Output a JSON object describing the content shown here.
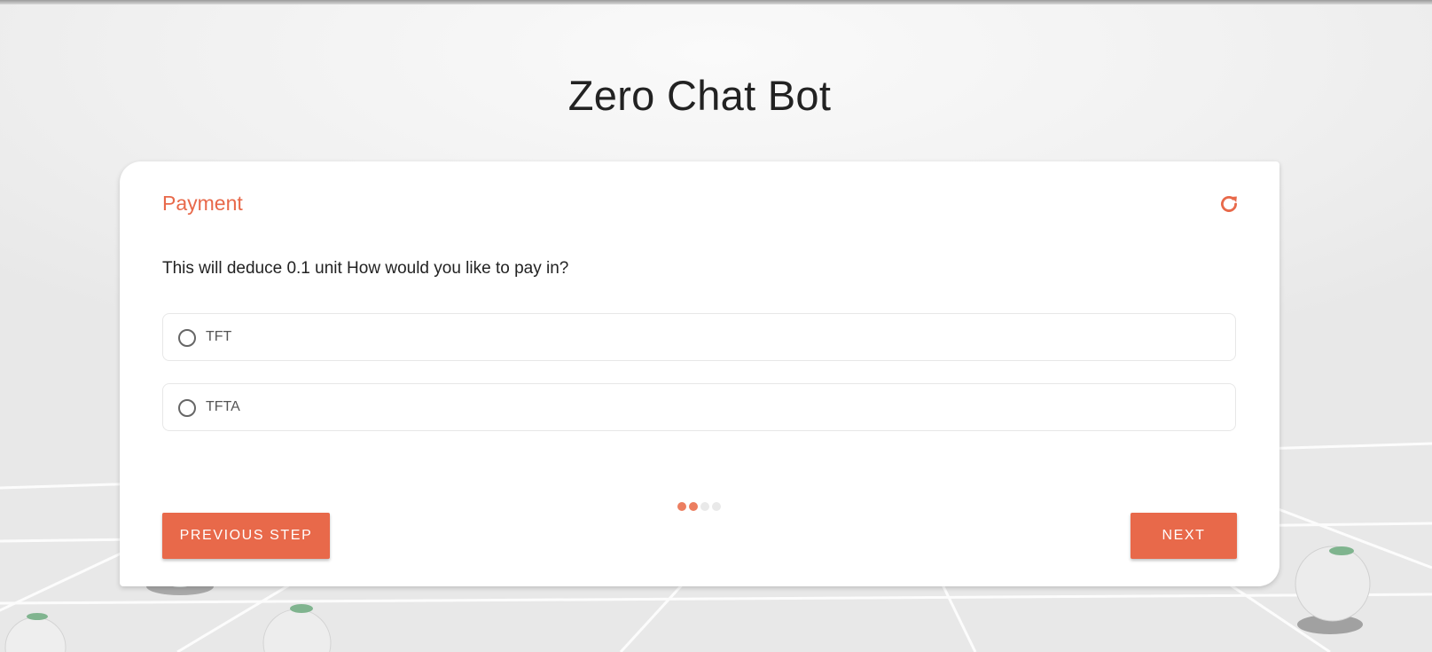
{
  "page": {
    "title": "Zero Chat Bot"
  },
  "card": {
    "title": "Payment",
    "refresh_icon": "refresh-icon",
    "question": "This will deduce 0.1 unit How would you like to pay in?",
    "options": [
      {
        "label": "TFT",
        "selected": false
      },
      {
        "label": "TFTA",
        "selected": false
      }
    ],
    "progress": {
      "total_steps": 4,
      "completed_steps": 2
    },
    "buttons": {
      "previous_label": "PREVIOUS STEP",
      "next_label": "NEXT"
    }
  },
  "colors": {
    "accent": "#e8694a",
    "dot_active": "#ec7e60",
    "dot_inactive": "#e9e9e9"
  }
}
